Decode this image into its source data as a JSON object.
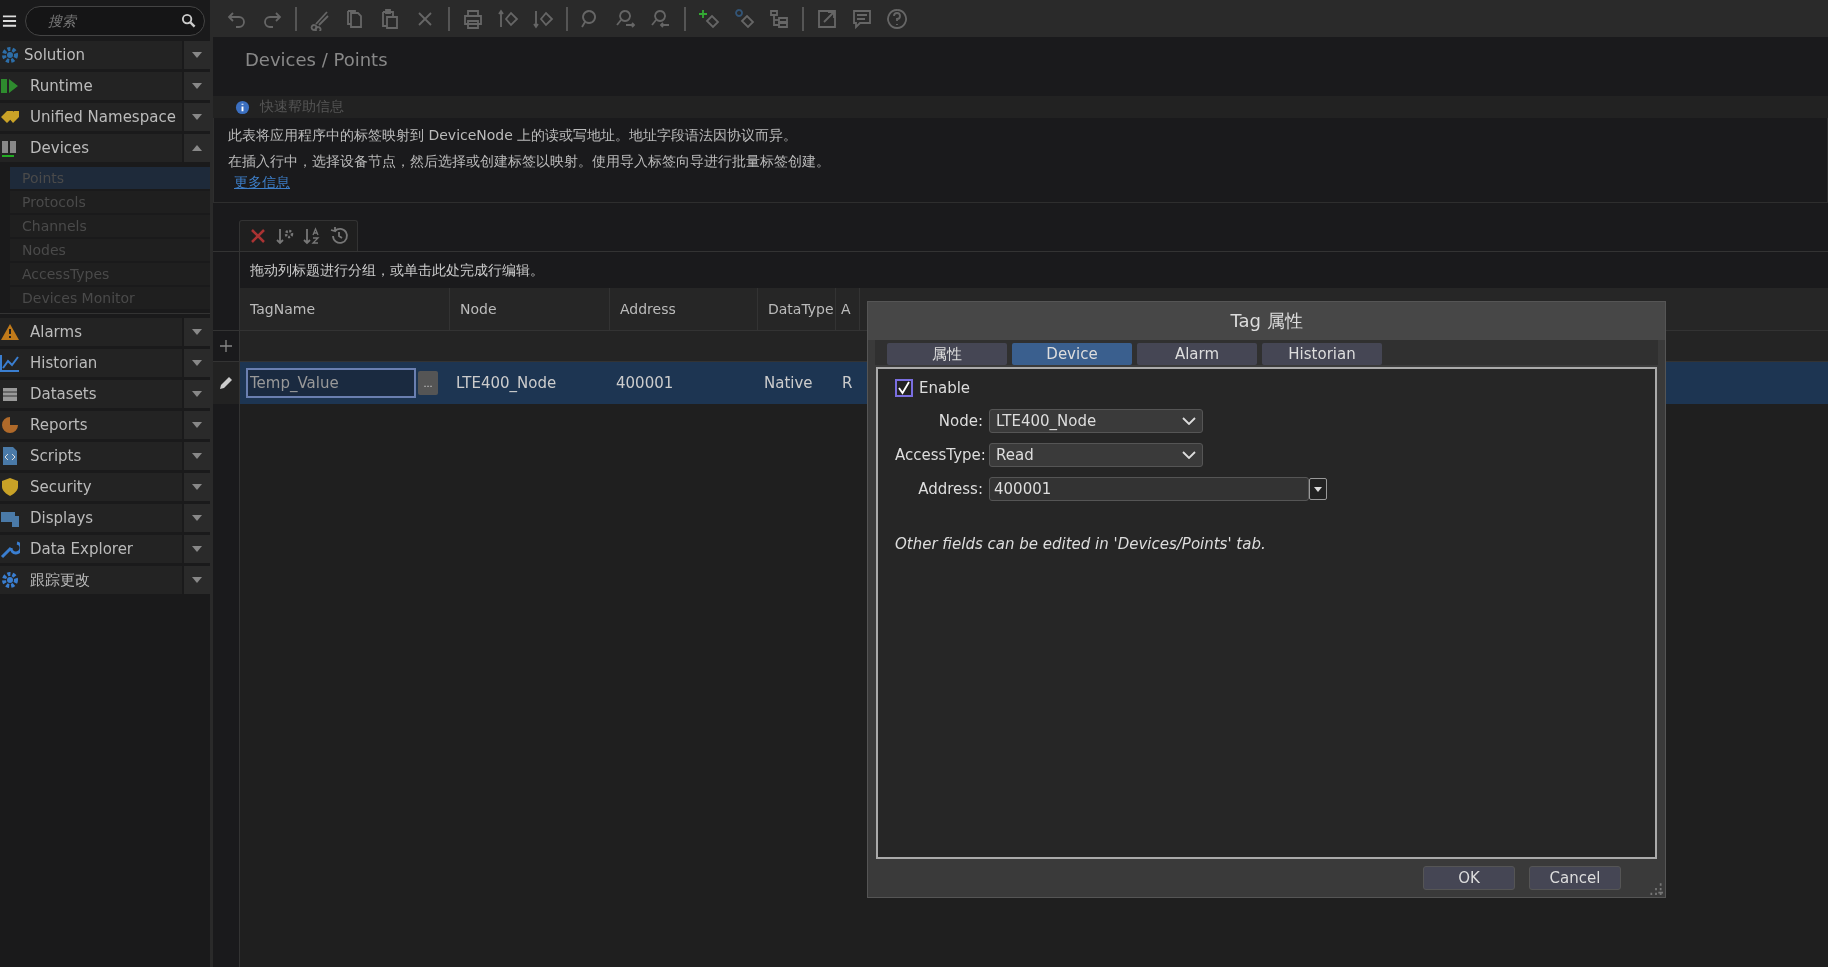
{
  "search": {
    "placeholder": "搜索"
  },
  "sidebar": {
    "items": [
      {
        "label": "Solution",
        "expanded": false
      },
      {
        "label": "Runtime",
        "expanded": false
      },
      {
        "label": "Unified Namespace",
        "expanded": false
      },
      {
        "label": "Devices",
        "expanded": true,
        "children": [
          {
            "label": "Points",
            "selected": true
          },
          {
            "label": "Protocols",
            "selected": false
          },
          {
            "label": "Channels",
            "selected": false
          },
          {
            "label": "Nodes",
            "selected": false
          },
          {
            "label": "AccessTypes",
            "selected": false
          },
          {
            "label": "Devices Monitor",
            "selected": false
          }
        ]
      },
      {
        "label": "Alarms",
        "expanded": false
      },
      {
        "label": "Historian",
        "expanded": false
      },
      {
        "label": "Datasets",
        "expanded": false
      },
      {
        "label": "Reports",
        "expanded": false
      },
      {
        "label": "Scripts",
        "expanded": false
      },
      {
        "label": "Security",
        "expanded": false
      },
      {
        "label": "Displays",
        "expanded": false
      },
      {
        "label": "Data Explorer",
        "expanded": false
      },
      {
        "label": "跟踪更改",
        "expanded": false
      }
    ]
  },
  "page_title": "Devices / Points",
  "help": {
    "title": "快速帮助信息",
    "lines": [
      "此表将应用程序中的标签映射到 DeviceNode 上的读或写地址。地址字段语法因协议而异。",
      "在插入行中，选择设备节点，然后选择或创建标签以映射。使用导入标签向导进行批量标签创建。"
    ],
    "link": "更多信息"
  },
  "group_hint": "拖动列标题进行分组，或单击此处完成行编辑。",
  "table": {
    "columns": [
      "TagName",
      "Node",
      "Address",
      "DataType",
      "A"
    ],
    "rows": [
      {
        "cells": [
          "Temp_Value",
          "LTE400_Node",
          "400001",
          "Native",
          "R"
        ],
        "selected": true,
        "editing": true,
        "edit_button": "..."
      }
    ]
  },
  "dialog": {
    "title": "Tag 属性",
    "tabs": [
      {
        "label": "属性",
        "selected": false
      },
      {
        "label": "Device",
        "selected": true
      },
      {
        "label": "Alarm",
        "selected": false
      },
      {
        "label": "Historian",
        "selected": false
      }
    ],
    "enable": {
      "label": "Enable",
      "checked": true
    },
    "fields": [
      {
        "label": "Node:",
        "value": "LTE400_Node",
        "kind": "dropdown"
      },
      {
        "label": "AccessType:",
        "value": "Read",
        "kind": "dropdown"
      },
      {
        "label": "Address:",
        "value": "400001",
        "kind": "text"
      }
    ],
    "note": "Other fields can be edited in 'Devices/Points' tab.",
    "buttons": [
      "OK",
      "Cancel"
    ]
  }
}
